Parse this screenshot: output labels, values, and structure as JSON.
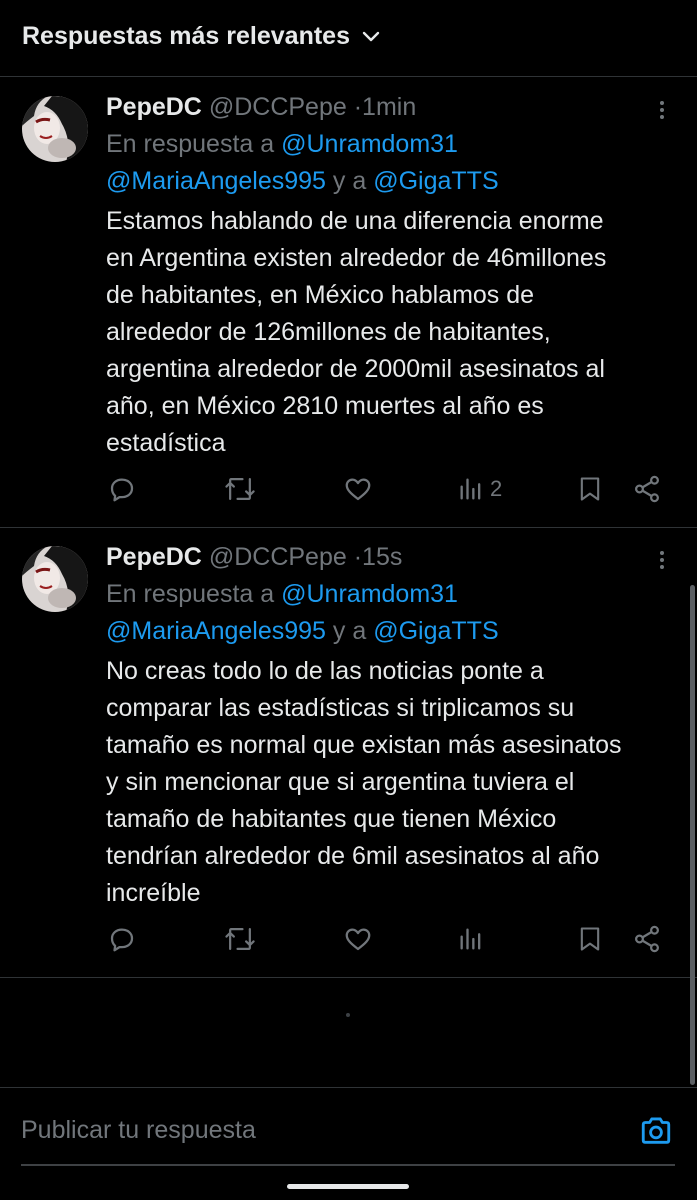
{
  "header": {
    "sort_label": "Respuestas más relevantes"
  },
  "tweets": [
    {
      "name": "PepeDC",
      "handle": "@DCCPepe",
      "dot": "·",
      "time": "1min",
      "reply_prefix": "En respuesta a",
      "mention1": "@Unramdom31",
      "mention2": "@MariaAngeles995",
      "reply_and": "y a",
      "mention3": "@GigaTTS",
      "lines": [
        "Estamos hablando de una diferencia enorme",
        "en Argentina existen alrededor de 46millones",
        "de habitantes, en México hablamos de",
        "alrededor de 126millones de habitantes,",
        "argentina alrededor de 2000mil asesinatos al",
        "año, en México 2810 muertes al año es",
        "estadística"
      ],
      "views": "2"
    },
    {
      "name": "PepeDC",
      "handle": "@DCCPepe",
      "dot": "·",
      "time": "15s",
      "reply_prefix": "En respuesta a",
      "mention1": "@Unramdom31",
      "mention2": "@MariaAngeles995",
      "reply_and": "y a",
      "mention3": "@GigaTTS",
      "lines": [
        "No creas todo lo de las noticias ponte a",
        "comparar las estadísticas si triplicamos su",
        "tamaño es normal que existan más asesinatos",
        "y sin mencionar que si argentina tuviera el",
        "tamaño de habitantes que tienen México",
        "tendrían alrededor de 6mil asesinatos al año",
        "increíble"
      ],
      "views": ""
    }
  ],
  "composer": {
    "placeholder": "Publicar tu respuesta"
  },
  "colors": {
    "accent": "#1d9bf0",
    "muted": "#71767b",
    "text": "#e7e9ea",
    "background": "#000000"
  },
  "icons": [
    "chevron-down-icon",
    "more-icon",
    "reply-icon",
    "retweet-icon",
    "like-icon",
    "views-icon",
    "bookmark-icon",
    "share-icon",
    "camera-icon"
  ]
}
